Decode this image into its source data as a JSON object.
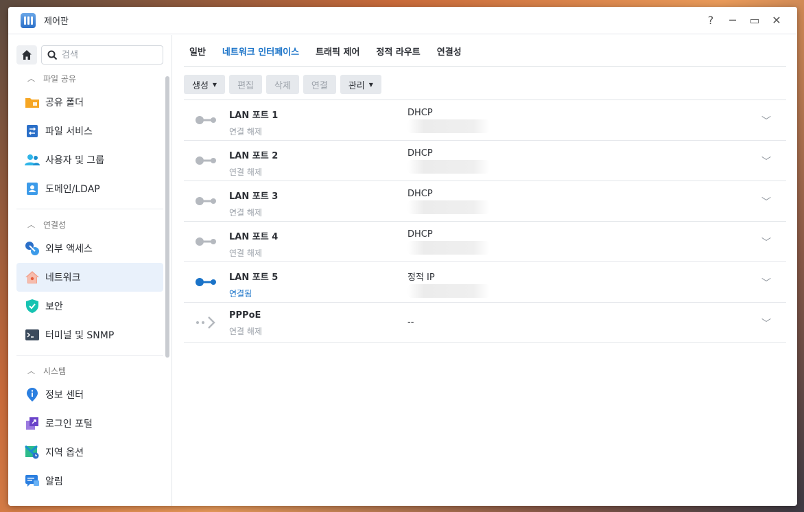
{
  "window": {
    "title": "제어판"
  },
  "titlebar": {
    "help": "?",
    "minimize": "─",
    "maximize": "▭",
    "close": "✕"
  },
  "search": {
    "placeholder": "검색"
  },
  "sidebar": {
    "sections": [
      {
        "label": "파일 공유",
        "items": [
          {
            "label": "공유 폴더",
            "icon": "folder-icon"
          },
          {
            "label": "파일 서비스",
            "icon": "file-service-icon"
          },
          {
            "label": "사용자 및 그룹",
            "icon": "users-icon"
          },
          {
            "label": "도메인/LDAP",
            "icon": "domain-icon"
          }
        ]
      },
      {
        "label": "연결성",
        "items": [
          {
            "label": "외부 액세스",
            "icon": "external-access-icon"
          },
          {
            "label": "네트워크",
            "icon": "network-home-icon",
            "active": true
          },
          {
            "label": "보안",
            "icon": "shield-icon"
          },
          {
            "label": "터미널 및 SNMP",
            "icon": "terminal-icon"
          }
        ]
      },
      {
        "label": "시스템",
        "items": [
          {
            "label": "정보 센터",
            "icon": "info-icon"
          },
          {
            "label": "로그인 포털",
            "icon": "login-portal-icon"
          },
          {
            "label": "지역 옵션",
            "icon": "regional-options-icon"
          },
          {
            "label": "알림",
            "icon": "notification-icon"
          }
        ]
      }
    ]
  },
  "tabs": [
    "일반",
    "네트워크 인터페이스",
    "트래픽 제어",
    "정적 라우트",
    "연결성"
  ],
  "active_tab": 1,
  "toolbar": {
    "create": "생성",
    "edit": "편집",
    "delete": "삭제",
    "connect": "연결",
    "manage": "관리"
  },
  "interfaces": [
    {
      "name": "LAN 포트 1",
      "status": "연결 해제",
      "mode": "DHCP",
      "connected": false
    },
    {
      "name": "LAN 포트 2",
      "status": "연결 해제",
      "mode": "DHCP",
      "connected": false
    },
    {
      "name": "LAN 포트 3",
      "status": "연결 해제",
      "mode": "DHCP",
      "connected": false
    },
    {
      "name": "LAN 포트 4",
      "status": "연결 해제",
      "mode": "DHCP",
      "connected": false
    },
    {
      "name": "LAN 포트 5",
      "status": "연결됨",
      "mode": "정적 IP",
      "connected": true
    },
    {
      "name": "PPPoE",
      "status": "연결 해제",
      "mode": "",
      "value": "--",
      "connected": false
    }
  ],
  "colors": {
    "accent": "#1a73c8",
    "inactive_port": "#b5b9bf"
  }
}
